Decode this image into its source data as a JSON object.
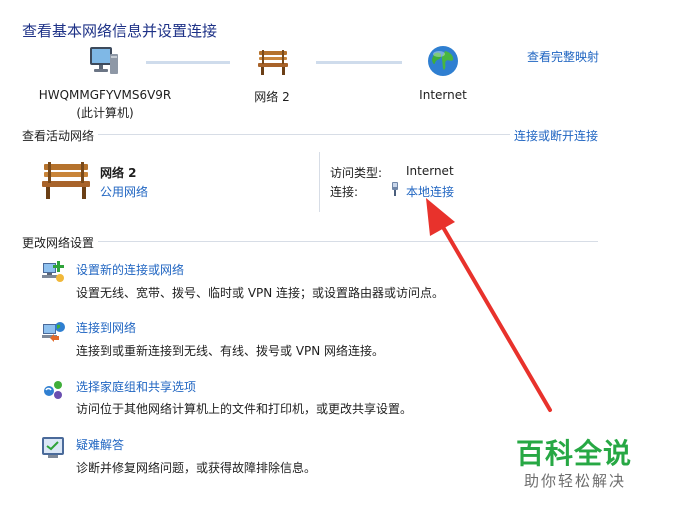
{
  "header": {
    "title": "查看基本网络信息并设置连接",
    "full_map_link": "查看完整映射"
  },
  "network_map": {
    "computer_name": "HWQMMGFYVMS6V9R",
    "computer_sub": "(此计算机)",
    "network_name": "网络  2",
    "internet_label": "Internet"
  },
  "active_networks": {
    "section_label": "查看活动网络",
    "connect_link": "连接或断开连接",
    "network_name": "网络  2",
    "network_type": "公用网络",
    "access_type_label": "访问类型:",
    "access_type_value": "Internet",
    "connection_label": "连接:",
    "connection_value": "本地连接"
  },
  "change_settings": {
    "section_label": "更改网络设置",
    "tasks": [
      {
        "title": "设置新的连接或网络",
        "desc": "设置无线、宽带、拨号、临时或 VPN 连接；或设置路由器或访问点。"
      },
      {
        "title": "连接到网络",
        "desc": "连接到或重新连接到无线、有线、拨号或 VPN 网络连接。"
      },
      {
        "title": "选择家庭组和共享选项",
        "desc": "访问位于其他网络计算机上的文件和打印机，或更改共享设置。"
      },
      {
        "title": "疑难解答",
        "desc": "诊断并修复网络问题，或获得故障排除信息。"
      }
    ]
  },
  "watermark": {
    "main": "百科全说",
    "sub": "助你轻松解决"
  },
  "colors": {
    "link": "#2166c2",
    "title": "#1e3287",
    "annotation_arrow": "#e8322c",
    "watermark_green": "#27a844"
  }
}
